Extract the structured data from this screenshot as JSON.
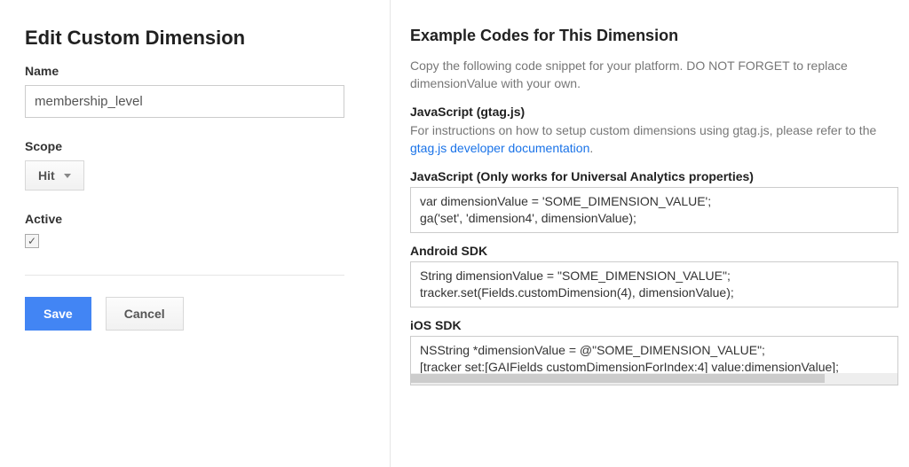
{
  "page": {
    "title": "Edit Custom Dimension",
    "name_label": "Name",
    "name_value": "membership_level",
    "scope_label": "Scope",
    "scope_value": "Hit",
    "active_label": "Active",
    "active_checked": true,
    "save_label": "Save",
    "cancel_label": "Cancel"
  },
  "example": {
    "heading": "Example Codes for This Dimension",
    "intro": "Copy the following code snippet for your platform. DO NOT FORGET to replace dimensionValue with your own.",
    "gtag_head": "JavaScript (gtag.js)",
    "gtag_desc_prefix": "For instructions on how to setup custom dimensions using gtag.js, please refer to the ",
    "gtag_link_text": "gtag.js developer documentation",
    "gtag_desc_suffix": ".",
    "js_head": "JavaScript (Only works for Universal Analytics properties)",
    "js_code": "var dimensionValue = 'SOME_DIMENSION_VALUE';\nga('set', 'dimension4', dimensionValue);",
    "android_head": "Android SDK",
    "android_code": "String dimensionValue = \"SOME_DIMENSION_VALUE\";\ntracker.set(Fields.customDimension(4), dimensionValue);",
    "ios_head": "iOS SDK",
    "ios_code": "NSString *dimensionValue = @\"SOME_DIMENSION_VALUE\";\n[tracker set:[GAIFields customDimensionForIndex:4] value:dimensionValue];"
  }
}
